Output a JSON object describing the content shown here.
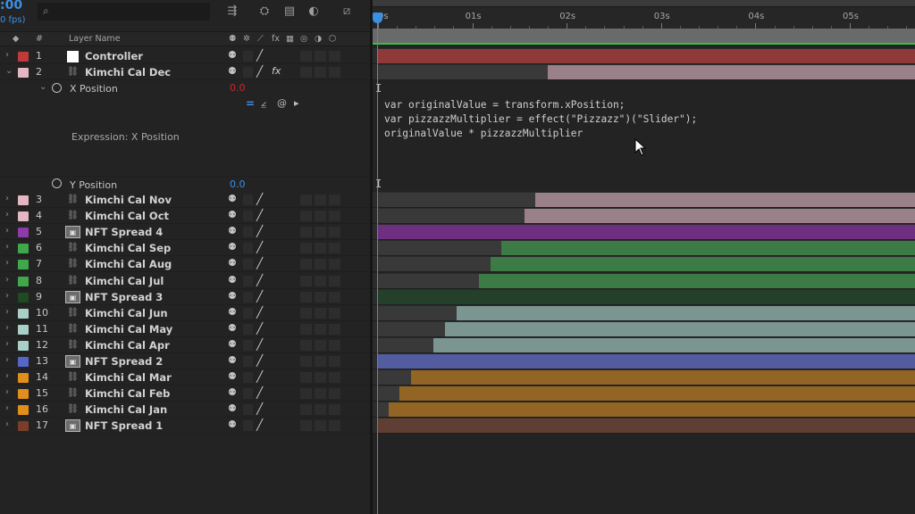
{
  "header": {
    "timecode": ":00",
    "fps": "0 fps)",
    "search_placeholder": ""
  },
  "columns": {
    "layer_name": "Layer Name",
    "hash": "#"
  },
  "timeline": {
    "ticks": [
      "0s",
      "01s",
      "02s",
      "03s",
      "04s",
      "05s"
    ]
  },
  "colors": {
    "accent": "#3b8fe3",
    "red": "#c72a2a",
    "workarea_green": "#38c145"
  },
  "layers": [
    {
      "num": "1",
      "name": "Controller",
      "type": "solid",
      "label": "#c03a3a",
      "bar": "#8f3939",
      "bar_start": 0.0
    },
    {
      "num": "2",
      "name": "Kimchi Cal Dec",
      "type": "shape",
      "label": "#e5b7c2",
      "bar": "#9a8088",
      "bar_start": 1.8
    },
    {
      "num": "3",
      "name": "Kimchi Cal Nov",
      "type": "shape",
      "label": "#e5b7c2",
      "bar": "#9a8088",
      "bar_start": 1.67
    },
    {
      "num": "4",
      "name": "Kimchi Cal Oct",
      "type": "shape",
      "label": "#e5b7c2",
      "bar": "#9a8088",
      "bar_start": 1.55
    },
    {
      "num": "5",
      "name": "NFT Spread 4",
      "type": "comp",
      "label": "#8e3aa8",
      "bar": "#6f2f80",
      "bar_start": 0.0
    },
    {
      "num": "6",
      "name": "Kimchi Cal Sep",
      "type": "shape",
      "label": "#3fa84a",
      "bar": "#3c7a46",
      "bar_start": 1.31
    },
    {
      "num": "7",
      "name": "Kimchi Cal Aug",
      "type": "shape",
      "label": "#3fa84a",
      "bar": "#3c7a46",
      "bar_start": 1.19
    },
    {
      "num": "8",
      "name": "Kimchi Cal Jul",
      "type": "shape",
      "label": "#3fa84a",
      "bar": "#3c7a46",
      "bar_start": 1.07
    },
    {
      "num": "9",
      "name": "NFT Spread 3",
      "type": "comp",
      "label": "#1f4a24",
      "bar": "#24402a",
      "bar_start": 0.0
    },
    {
      "num": "10",
      "name": "Kimchi Cal Jun",
      "type": "shape",
      "label": "#a9d0c8",
      "bar": "#7b9590",
      "bar_start": 0.83
    },
    {
      "num": "11",
      "name": "Kimchi Cal May",
      "type": "shape",
      "label": "#a9d0c8",
      "bar": "#7b9590",
      "bar_start": 0.71
    },
    {
      "num": "12",
      "name": "Kimchi Cal Apr",
      "type": "shape",
      "label": "#a9d0c8",
      "bar": "#7b9590",
      "bar_start": 0.59
    },
    {
      "num": "13",
      "name": "NFT Spread 2",
      "type": "comp",
      "label": "#5566c9",
      "bar": "#535c9e",
      "bar_start": 0.0
    },
    {
      "num": "14",
      "name": "Kimchi Cal Mar",
      "type": "shape",
      "label": "#e38e1b",
      "bar": "#926525",
      "bar_start": 0.35
    },
    {
      "num": "15",
      "name": "Kimchi Cal Feb",
      "type": "shape",
      "label": "#e38e1b",
      "bar": "#926525",
      "bar_start": 0.23
    },
    {
      "num": "16",
      "name": "Kimchi Cal Jan",
      "type": "shape",
      "label": "#e38e1b",
      "bar": "#926525",
      "bar_start": 0.11
    },
    {
      "num": "17",
      "name": "NFT Spread 1",
      "type": "comp",
      "label": "#7a3e28",
      "bar": "#5f3e33",
      "bar_start": 0.0
    }
  ],
  "properties": {
    "x_position": {
      "label": "X Position",
      "value": "0.0",
      "expression_label": "Expression: X Position"
    },
    "y_position": {
      "label": "Y Position",
      "value": "0.0"
    }
  },
  "expression": {
    "line1": "var originalValue = transform.xPosition;",
    "line2": "var pizzazzMultiplier = effect(\"Pizzazz\")(\"Slider\");",
    "line3": "originalValue * pizzazzMultiplier"
  }
}
